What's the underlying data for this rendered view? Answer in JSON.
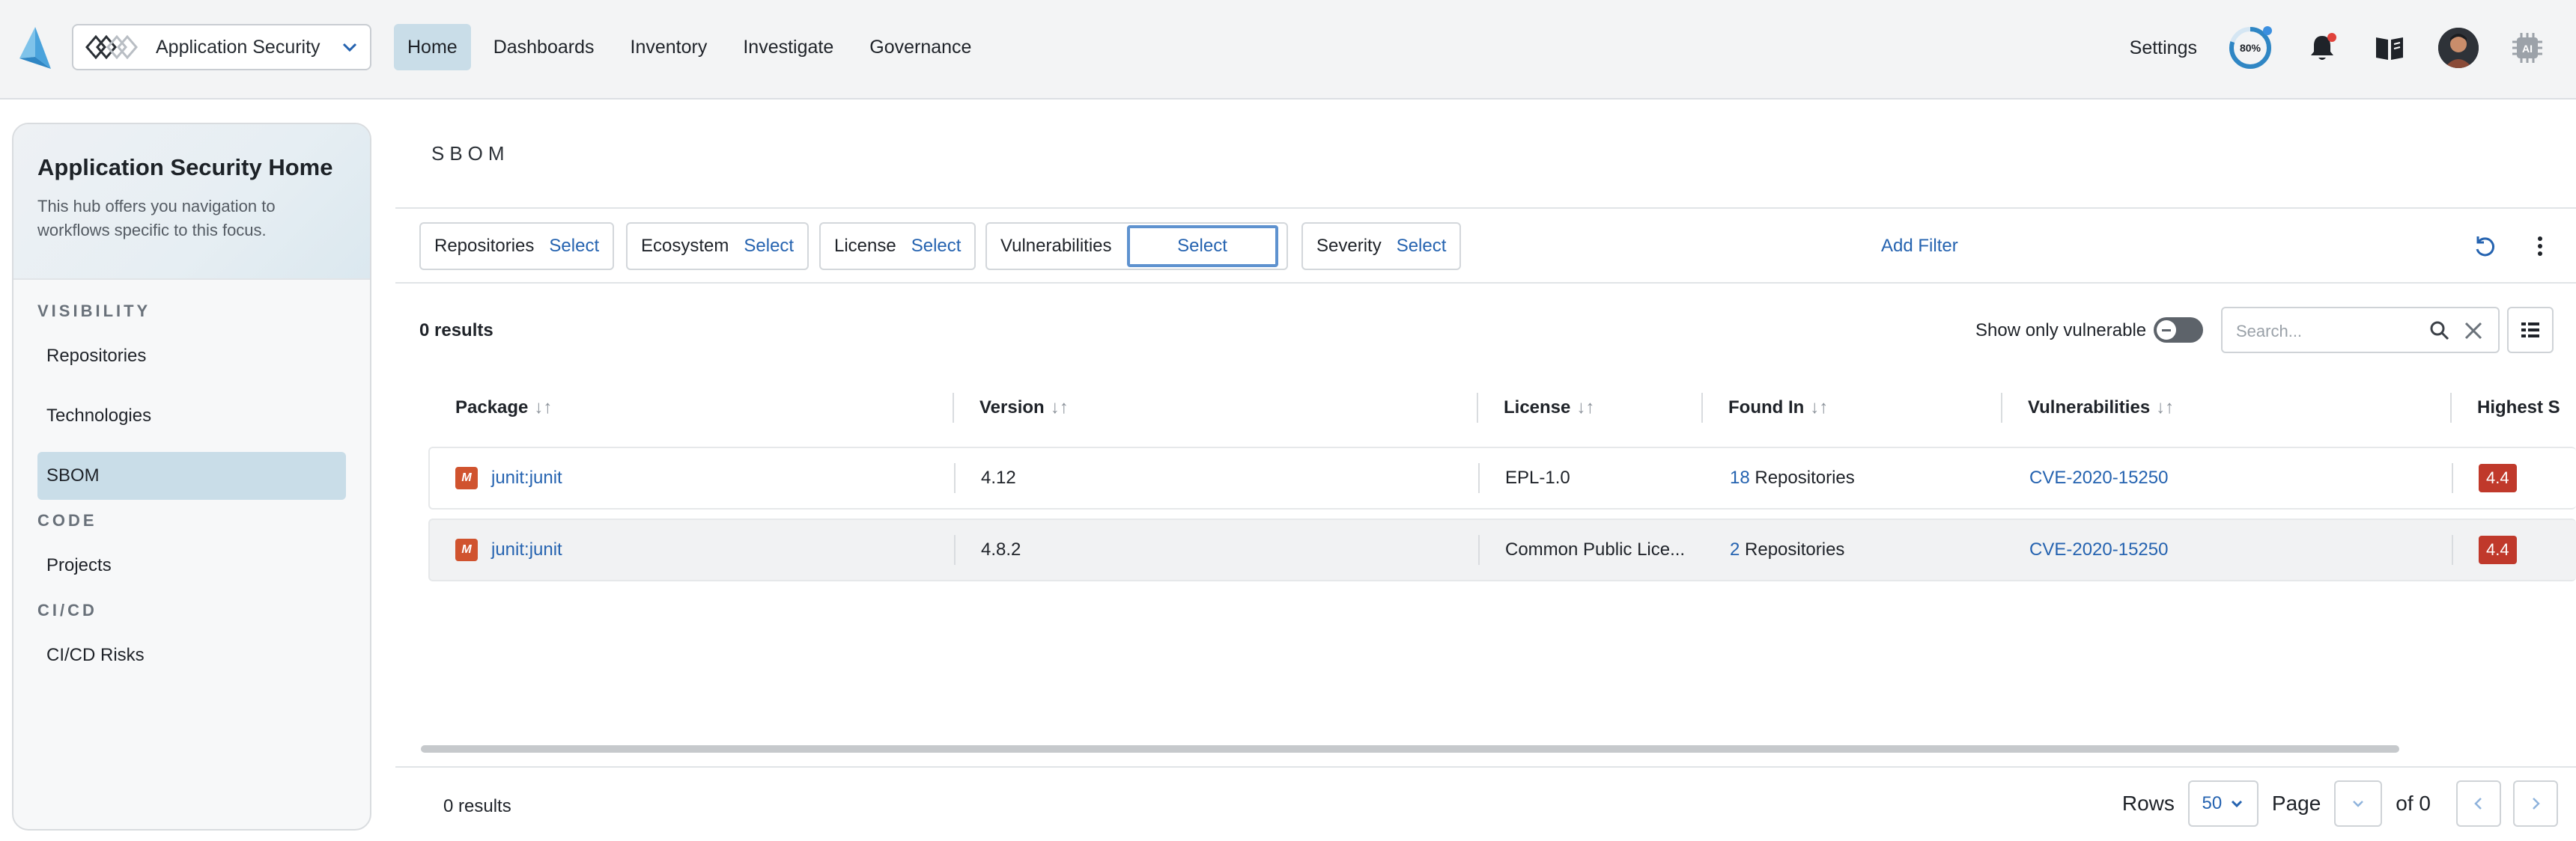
{
  "header": {
    "app_switcher_label": "Application Security",
    "nav": [
      {
        "label": "Home",
        "active": true
      },
      {
        "label": "Dashboards"
      },
      {
        "label": "Inventory"
      },
      {
        "label": "Investigate"
      },
      {
        "label": "Governance"
      }
    ],
    "settings_label": "Settings",
    "progress_text": "80%",
    "progress_value": 0.8,
    "ai_label": "AI"
  },
  "sidebar": {
    "title": "Application Security Home",
    "description": "This hub offers you navigation to workflows specific to this focus.",
    "groups": [
      {
        "label": "VISIBILITY",
        "items": [
          "Repositories",
          "Technologies",
          "SBOM"
        ]
      },
      {
        "label": "CODE",
        "items": [
          "Projects"
        ]
      },
      {
        "label": "CI/CD",
        "items": [
          "CI/CD Risks"
        ]
      }
    ],
    "active_item": "SBOM"
  },
  "main": {
    "title": "SBOM",
    "filters": [
      {
        "label": "Repositories",
        "value": "Select"
      },
      {
        "label": "Ecosystem",
        "value": "Select"
      },
      {
        "label": "License",
        "value": "Select"
      },
      {
        "label": "Vulnerabilities",
        "value": "Select"
      },
      {
        "label": "Severity",
        "value": "Select"
      }
    ],
    "add_filter_label": "Add Filter",
    "results_count": "0 results",
    "show_vulnerable_label": "Show only vulnerable",
    "search_placeholder": "Search...",
    "columns": [
      "Package",
      "Version",
      "License",
      "Found In",
      "Vulnerabilities",
      "Highest S"
    ],
    "rows": [
      {
        "package": "junit:junit",
        "version": "4.12",
        "license": "EPL-1.0",
        "found_count": "18",
        "found_suffix": "Repositories",
        "vulnerability": "CVE-2020-15250",
        "severity": "4.4"
      },
      {
        "package": "junit:junit",
        "version": "4.8.2",
        "license": "Common Public Lice...",
        "found_count": "2",
        "found_suffix": "Repositories",
        "vulnerability": "CVE-2020-15250",
        "severity": "4.4"
      }
    ],
    "package_badge": "M",
    "footer": {
      "results_count": "0 results",
      "rows_label": "Rows",
      "rows_value": "50",
      "page_label": "Page",
      "of_label": "of 0"
    }
  },
  "colors": {
    "accent": "#2563b0",
    "active_bg": "#c9dde8",
    "badge": "#d0532e",
    "severity": "#c0392b"
  }
}
